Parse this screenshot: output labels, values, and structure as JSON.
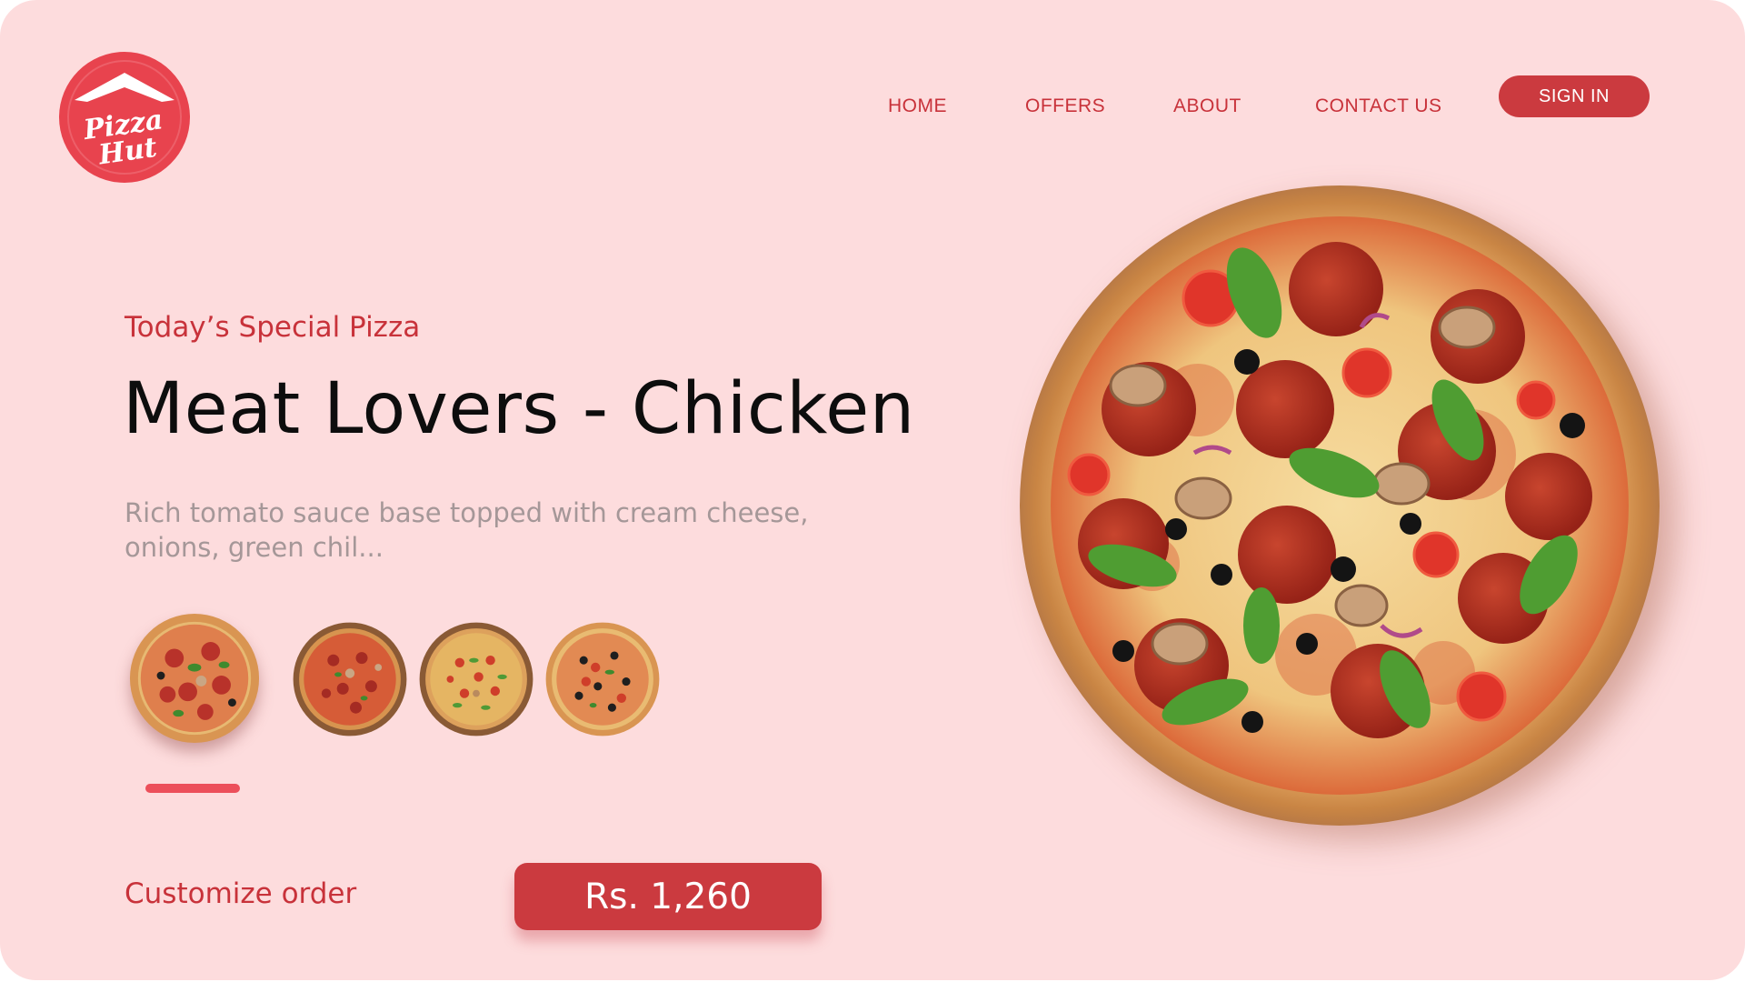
{
  "brand": {
    "logo_line1": "Pizza",
    "logo_line2": "Hut",
    "color": "#e8434e"
  },
  "nav": {
    "items": [
      "HOME",
      "OFFERS",
      "ABOUT",
      "CONTACT US"
    ],
    "signin_label": "SIGN IN"
  },
  "hero": {
    "eyebrow": "Today’s Special Pizza",
    "title": "Meat Lovers - Chicken",
    "description": "Rich tomato sauce base topped with cream cheese, onions, green chil...",
    "image_icon": "pizza-image"
  },
  "thumbnails": {
    "selected_index": 0,
    "items": [
      "pizza-thumbnail-1",
      "pizza-thumbnail-2",
      "pizza-thumbnail-3",
      "pizza-thumbnail-4"
    ]
  },
  "footer": {
    "customize_label": "Customize order",
    "price": "Rs. 1,260"
  },
  "colors": {
    "background": "#fddcdd",
    "accent": "#cb3a3f",
    "indicator": "#ec4f5a",
    "muted_text": "#a59798"
  }
}
